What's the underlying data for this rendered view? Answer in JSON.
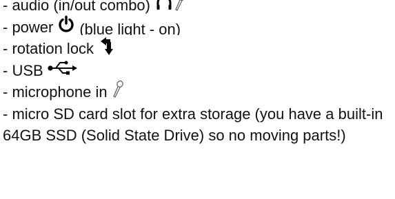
{
  "items": [
    {
      "text": "- audio (in/out combo)",
      "icons": [
        "headphones-icon",
        "microphone-icon"
      ]
    },
    {
      "text_before": "- power",
      "text_after": "(blue light - on)",
      "icons": [
        "power-icon"
      ]
    },
    {
      "text": "- rotation lock",
      "icons": [
        "rotation-lock-icon"
      ]
    },
    {
      "text": "- USB",
      "icons": [
        "usb-icon"
      ]
    },
    {
      "text": "- microphone in",
      "icons": [
        "microphone-icon"
      ]
    },
    {
      "text": "- micro SD card slot for extra storage (you have a built-in 64GB SSD (Solid State Drive) so no moving parts!)"
    }
  ],
  "colors": {
    "text": "#111111",
    "icon": "#000000",
    "mic_outline": "#555555"
  }
}
